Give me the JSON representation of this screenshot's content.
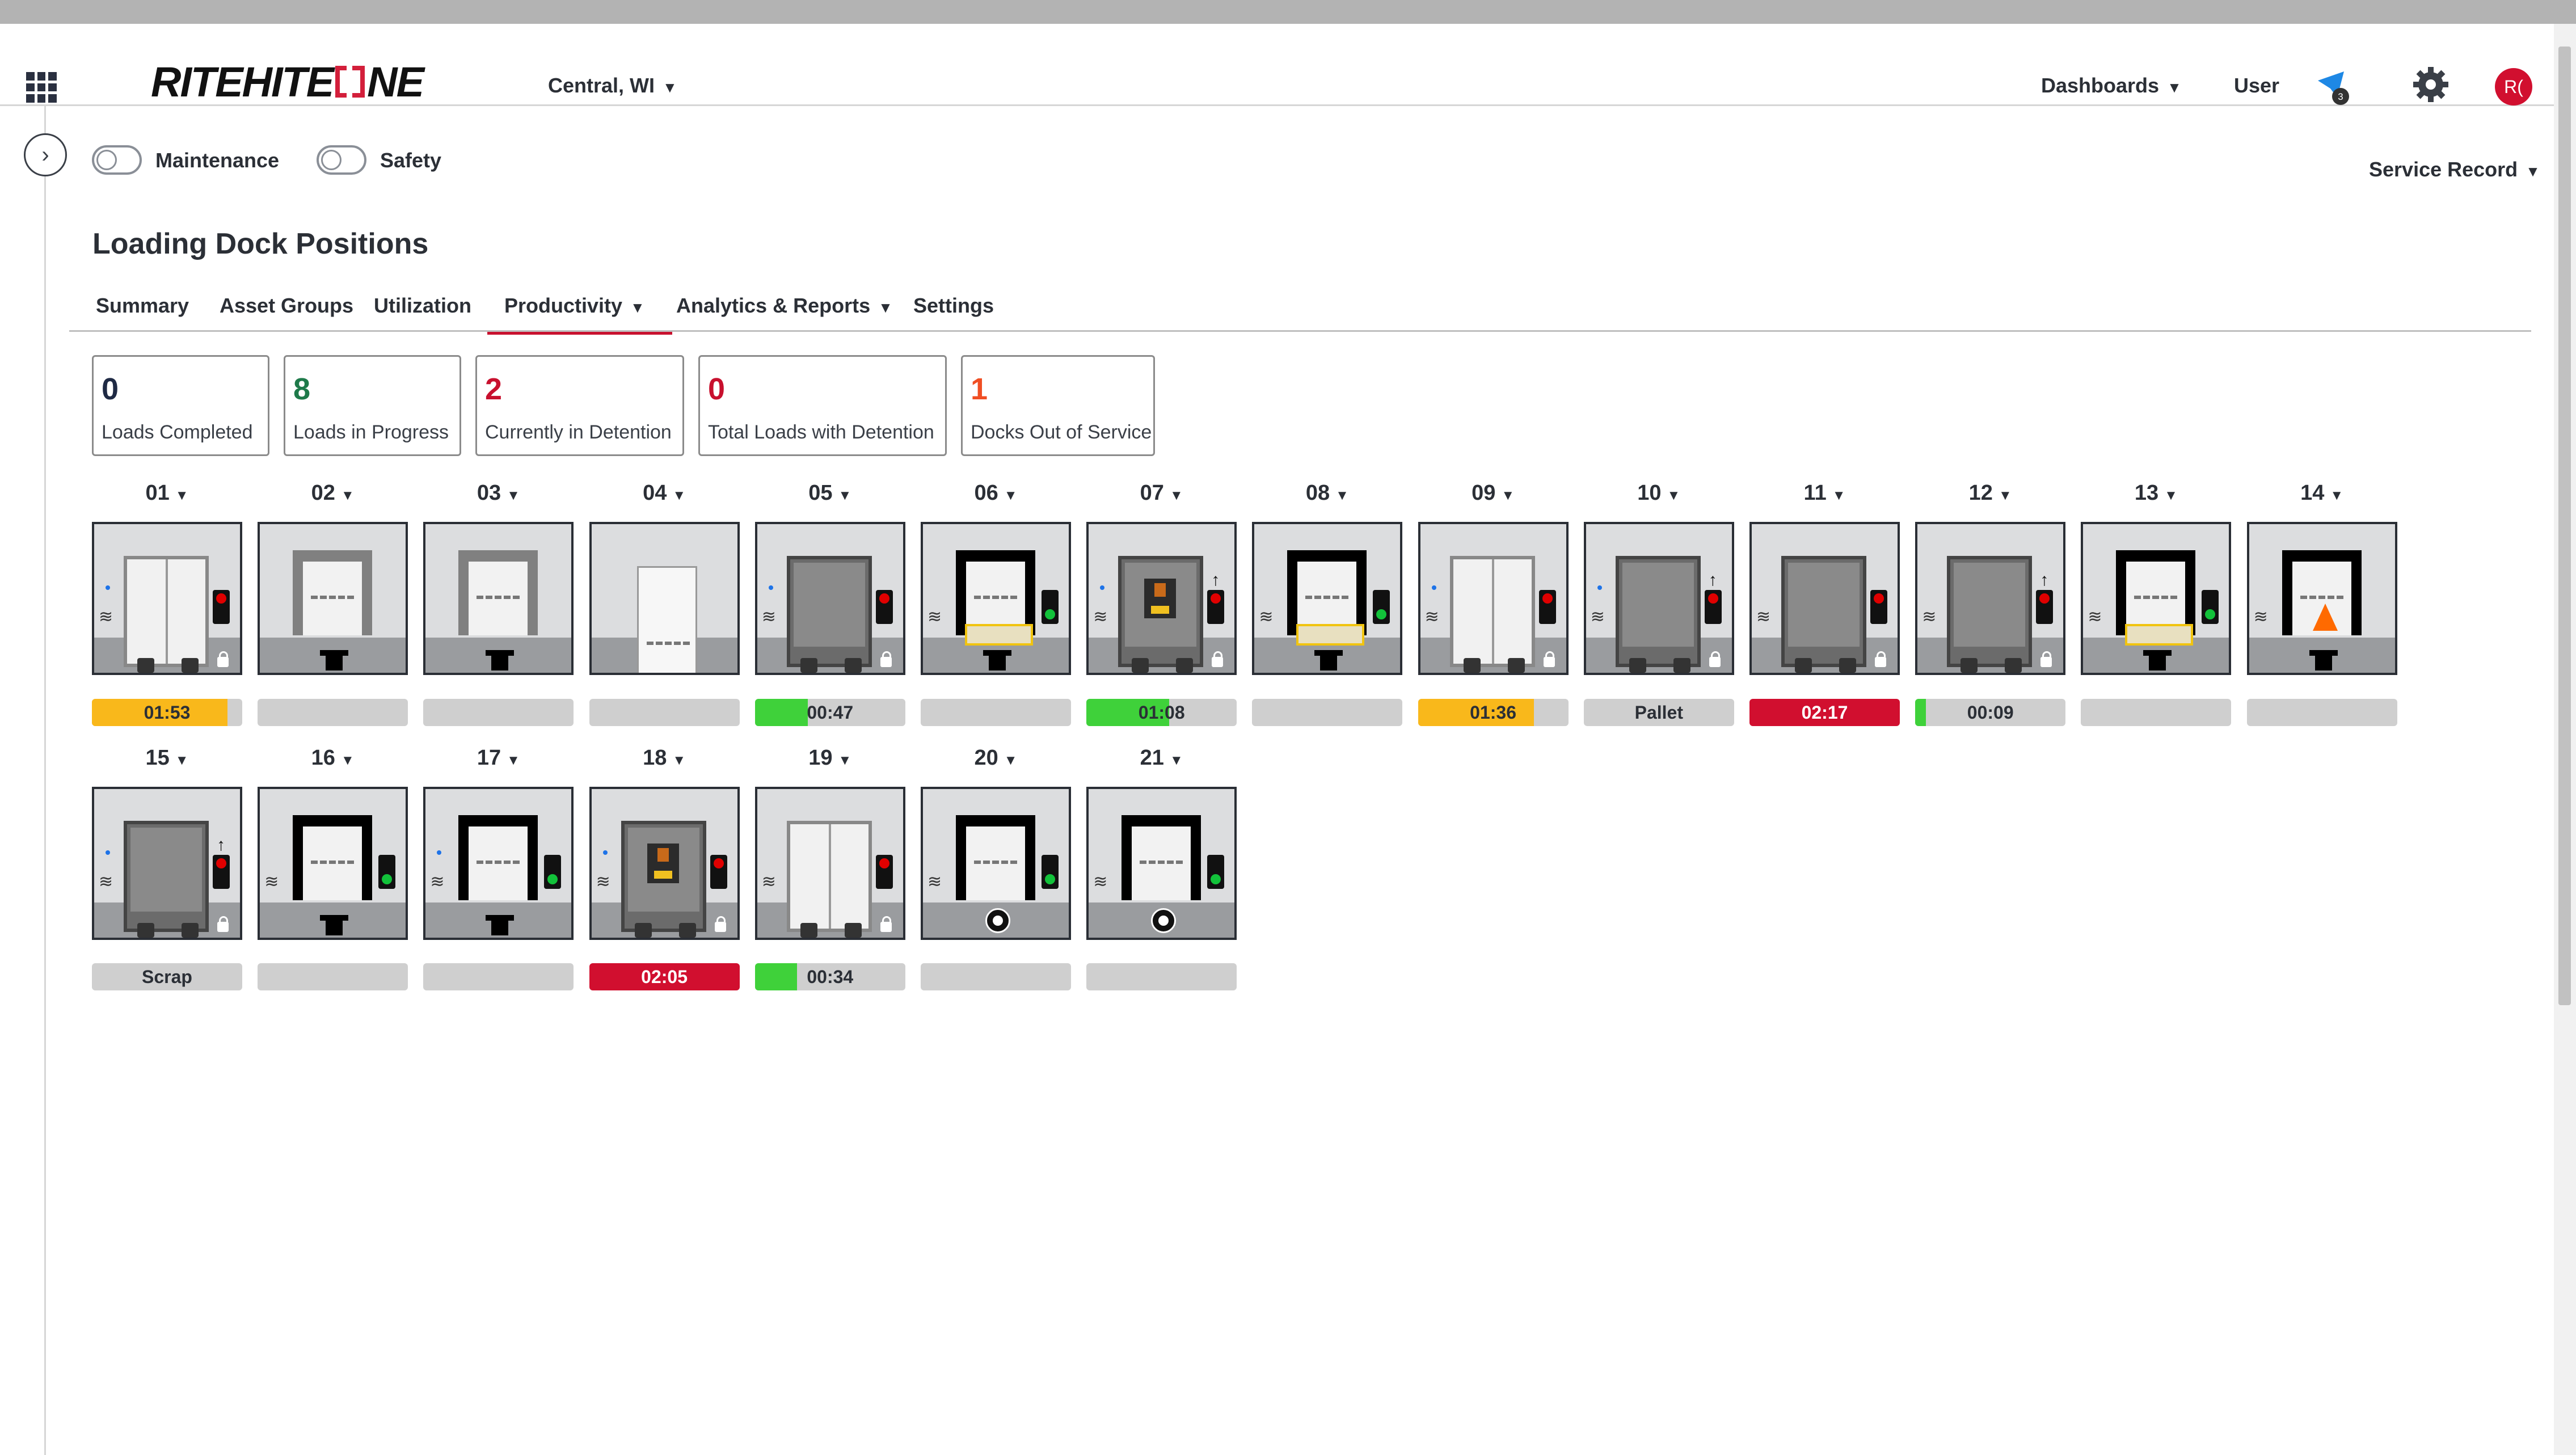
{
  "header": {
    "logo_text": "RITEHITE",
    "logo_suffix": "NE",
    "location": "Central, WI",
    "dashboards_label": "Dashboards",
    "user_label": "User",
    "notification_count": "3",
    "avatar_initials": "R("
  },
  "filters": {
    "maintenance_label": "Maintenance",
    "safety_label": "Safety",
    "service_record_label": "Service Record"
  },
  "page": {
    "title": "Loading Dock Positions"
  },
  "tabs": [
    {
      "label": "Summary"
    },
    {
      "label": "Asset Groups"
    },
    {
      "label": "Utilization"
    },
    {
      "label": "Productivity",
      "active": true
    },
    {
      "label": "Analytics & Reports"
    },
    {
      "label": "Settings"
    }
  ],
  "stats": [
    {
      "value": "0",
      "label": "Loads Completed",
      "color": "#1f2a44"
    },
    {
      "value": "8",
      "label": "Loads in Progress",
      "color": "#1e7a4a"
    },
    {
      "value": "2",
      "label": "Currently in Detention",
      "color": "#c8102e"
    },
    {
      "value": "0",
      "label": "Total Loads with Detention",
      "color": "#c8102e"
    },
    {
      "value": "1",
      "label": "Docks Out of Service",
      "color": "#f04e23"
    }
  ],
  "colors": {
    "yellow": "#f9b81b",
    "green": "#3fd13a",
    "red": "#d10f2f",
    "gray": "#cfcfcf"
  },
  "docks": [
    {
      "id": "01",
      "status_text": "01:53",
      "bar_color": "yellow",
      "bar_fill": 0.9
    },
    {
      "id": "02",
      "status_text": "",
      "bar_color": "gray",
      "bar_fill": 0
    },
    {
      "id": "03",
      "status_text": "",
      "bar_color": "gray",
      "bar_fill": 0
    },
    {
      "id": "04",
      "status_text": "",
      "bar_color": "gray",
      "bar_fill": 0
    },
    {
      "id": "05",
      "status_text": "00:47",
      "bar_color": "green",
      "bar_fill": 0.35
    },
    {
      "id": "06",
      "status_text": "",
      "bar_color": "gray",
      "bar_fill": 0
    },
    {
      "id": "07",
      "status_text": "01:08",
      "bar_color": "green",
      "bar_fill": 0.55
    },
    {
      "id": "08",
      "status_text": "",
      "bar_color": "gray",
      "bar_fill": 0
    },
    {
      "id": "09",
      "status_text": "01:36",
      "bar_color": "yellow",
      "bar_fill": 0.77
    },
    {
      "id": "10",
      "status_text": "Pallet",
      "bar_color": "gray",
      "bar_fill": 0
    },
    {
      "id": "11",
      "status_text": "02:17",
      "bar_color": "red",
      "bar_fill": 1
    },
    {
      "id": "12",
      "status_text": "00:09",
      "bar_color": "green",
      "bar_fill": 0.07
    },
    {
      "id": "13",
      "status_text": "",
      "bar_color": "gray",
      "bar_fill": 0
    },
    {
      "id": "14",
      "status_text": "",
      "bar_color": "gray",
      "bar_fill": 0
    },
    {
      "id": "15",
      "status_text": "Scrap",
      "bar_color": "gray",
      "bar_fill": 0
    },
    {
      "id": "16",
      "status_text": "",
      "bar_color": "gray",
      "bar_fill": 0
    },
    {
      "id": "17",
      "status_text": "",
      "bar_color": "gray",
      "bar_fill": 0
    },
    {
      "id": "18",
      "status_text": "02:05",
      "bar_color": "red",
      "bar_fill": 1
    },
    {
      "id": "19",
      "status_text": "00:34",
      "bar_color": "green",
      "bar_fill": 0.28
    },
    {
      "id": "20",
      "status_text": "",
      "bar_color": "gray",
      "bar_fill": 0
    },
    {
      "id": "21",
      "status_text": "",
      "bar_color": "gray",
      "bar_fill": 0
    }
  ]
}
